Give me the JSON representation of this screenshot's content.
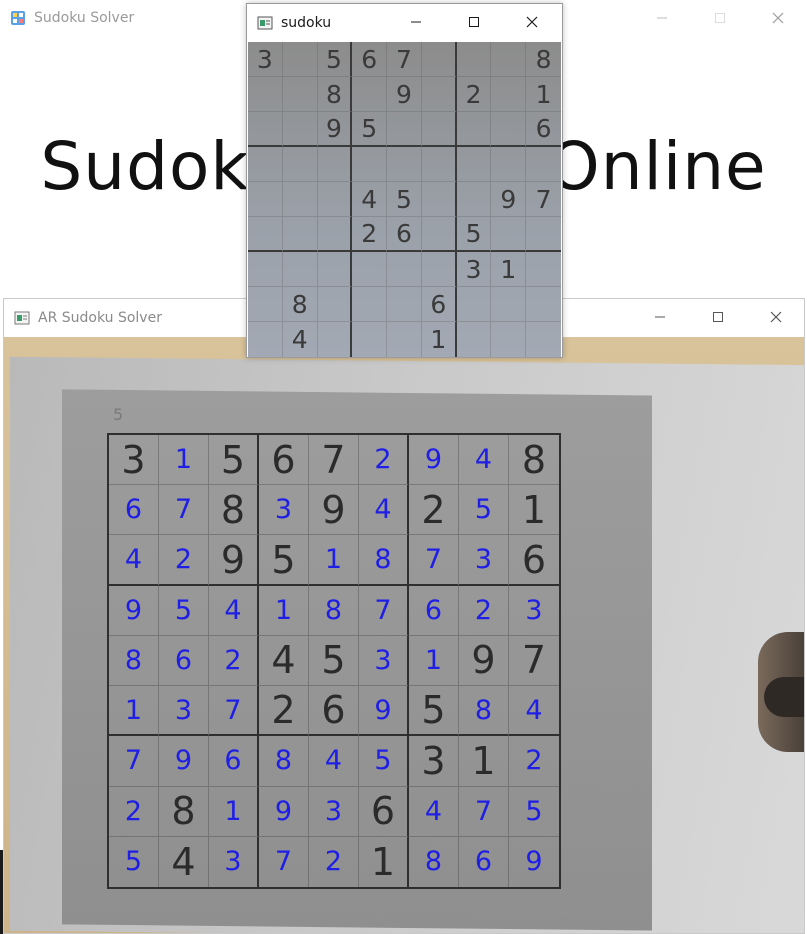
{
  "background_window": {
    "title": "Sudoku Solver",
    "heading": "Sudoku Solver Online",
    "icon": "sudoku-app-icon"
  },
  "ar_window": {
    "title": "AR Sudoku Solver",
    "icon": "camera-app-icon",
    "small_mark": "5",
    "grid": [
      [
        "3",
        "1",
        "5",
        "6",
        "7",
        "2",
        "9",
        "4",
        "8"
      ],
      [
        "6",
        "7",
        "8",
        "3",
        "9",
        "4",
        "2",
        "5",
        "1"
      ],
      [
        "4",
        "2",
        "9",
        "5",
        "1",
        "8",
        "7",
        "3",
        "6"
      ],
      [
        "9",
        "5",
        "4",
        "1",
        "8",
        "7",
        "6",
        "2",
        "3"
      ],
      [
        "8",
        "6",
        "2",
        "4",
        "5",
        "3",
        "1",
        "9",
        "7"
      ],
      [
        "1",
        "3",
        "7",
        "2",
        "6",
        "9",
        "5",
        "8",
        "4"
      ],
      [
        "7",
        "9",
        "6",
        "8",
        "4",
        "5",
        "3",
        "1",
        "2"
      ],
      [
        "2",
        "8",
        "1",
        "9",
        "3",
        "6",
        "4",
        "7",
        "5"
      ],
      [
        "5",
        "4",
        "3",
        "7",
        "2",
        "1",
        "8",
        "6",
        "9"
      ]
    ],
    "given_mask": [
      [
        1,
        0,
        1,
        1,
        1,
        0,
        0,
        0,
        1
      ],
      [
        0,
        0,
        1,
        0,
        1,
        0,
        1,
        0,
        1
      ],
      [
        0,
        0,
        1,
        1,
        0,
        0,
        0,
        0,
        1
      ],
      [
        0,
        0,
        0,
        0,
        0,
        0,
        0,
        0,
        0
      ],
      [
        0,
        0,
        0,
        1,
        1,
        0,
        0,
        1,
        1
      ],
      [
        0,
        0,
        0,
        1,
        1,
        0,
        1,
        0,
        0
      ],
      [
        0,
        0,
        0,
        0,
        0,
        0,
        1,
        1,
        0
      ],
      [
        0,
        1,
        0,
        0,
        0,
        1,
        0,
        0,
        0
      ],
      [
        0,
        1,
        0,
        0,
        0,
        1,
        0,
        0,
        0
      ]
    ],
    "colors": {
      "given": "#2b2b2b",
      "solved": "#1e1ee6"
    }
  },
  "sudoku_window": {
    "title": "sudoku",
    "icon": "image-window-icon",
    "grid": [
      [
        "3",
        "",
        "5",
        "6",
        "7",
        "",
        "",
        "",
        "8"
      ],
      [
        "",
        "",
        "8",
        "",
        "9",
        "",
        "2",
        "",
        "1"
      ],
      [
        "",
        "",
        "9",
        "5",
        "",
        "",
        "",
        "",
        "6"
      ],
      [
        "",
        "",
        "",
        "",
        "",
        "",
        "",
        "",
        ""
      ],
      [
        "",
        "",
        "",
        "4",
        "5",
        "",
        "",
        "9",
        "7"
      ],
      [
        "",
        "",
        "",
        "2",
        "6",
        "",
        "5",
        "",
        ""
      ],
      [
        "",
        "",
        "",
        "",
        "",
        "",
        "3",
        "1",
        ""
      ],
      [
        "",
        "8",
        "",
        "",
        "",
        "6",
        "",
        "",
        ""
      ],
      [
        "",
        "4",
        "",
        "",
        "",
        "1",
        "",
        "",
        ""
      ]
    ]
  },
  "controls": {
    "minimize_icon": "minimize-icon",
    "maximize_icon": "maximize-icon",
    "close_icon": "close-icon"
  }
}
